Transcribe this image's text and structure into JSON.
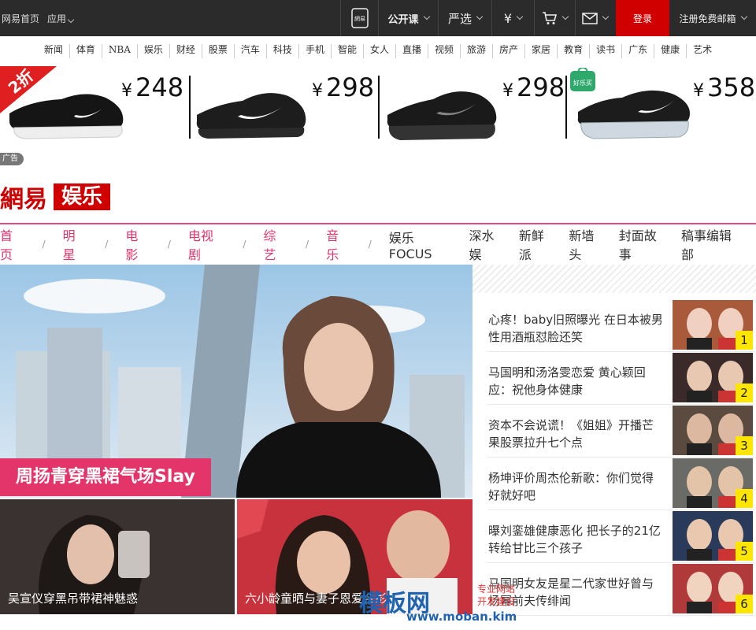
{
  "topbar": {
    "home": "网易首页",
    "apps": "应用",
    "phone_label": "網易",
    "open_course": "公开课",
    "yanxuan": "严选",
    "yen": "¥",
    "login": "登录",
    "register": "注册免费邮箱"
  },
  "channels": [
    "新闻",
    "体育",
    "NBA",
    "娱乐",
    "财经",
    "股票",
    "汽车",
    "科技",
    "手机",
    "智能",
    "女人",
    "直播",
    "视频",
    "旅游",
    "房产",
    "家居",
    "教育",
    "读书",
    "广东",
    "健康",
    "艺术"
  ],
  "ads": {
    "badge": "2折",
    "yen": "¥",
    "prices": [
      "248",
      "298",
      "298",
      "358"
    ],
    "tag_haole": "好乐买",
    "ad_tag": "广告"
  },
  "logo": {
    "netease": "網易",
    "yule": "娱乐"
  },
  "subnav": {
    "pink": [
      "首页",
      "明星",
      "电影",
      "电视剧",
      "综艺",
      "音乐"
    ],
    "sep": "/",
    "black": [
      "娱乐FOCUS",
      "深水娱",
      "新鲜派",
      "新墙头",
      "封面故事",
      "稿事编辑部"
    ]
  },
  "hero": {
    "caption": "周扬青穿黑裙气场Slay"
  },
  "thumbs": [
    {
      "caption": "吴宣仪穿黑吊带裙神魅惑"
    },
    {
      "caption": "六小龄童晒与妻子恩爱合影"
    }
  ],
  "news": [
    {
      "title": "心疼！baby旧照曝光 在日本被男性用酒瓶怼脸还笑",
      "num": "1"
    },
    {
      "title": "马国明和汤洛雯恋爱 黄心颖回应：祝他身体健康",
      "num": "2"
    },
    {
      "title": "资本不会说谎！《姐姐》开播芒果股票拉升七个点",
      "num": "3"
    },
    {
      "title": "杨坤评价周杰伦新歌：你们觉得好就好吧",
      "num": "4"
    },
    {
      "title": "曝刘銮雄健康恶化 把长子的21亿转给甘比三个孩子",
      "num": "5"
    },
    {
      "title": "马国明女友是星二代家世好曾与杨幂前夫传绯闻",
      "num": "6"
    }
  ],
  "watermark": {
    "main": "模板网",
    "sub": "www.moban.kim",
    "red1": "专业网站",
    "red2": "开发建设"
  },
  "colors": {
    "accent_red": "#d10000",
    "pink": "#e4356b",
    "badge_yellow": "#ffe600"
  }
}
